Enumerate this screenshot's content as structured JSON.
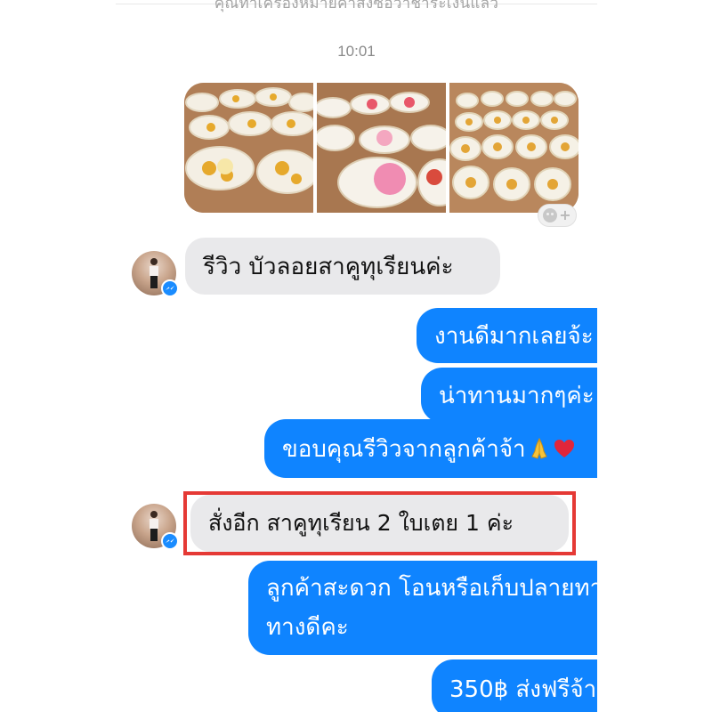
{
  "top_hint": "คุณทำเครื่องหมายคำสั่งซื้อว่าชำระเงินแล้ว",
  "timestamp": "10:01",
  "photos": [
    {
      "name": "photo-1"
    },
    {
      "name": "photo-2"
    },
    {
      "name": "photo-3"
    }
  ],
  "messages": {
    "review": "รีวิว บัวลอยสาคูทุเรียนค่ะ",
    "reply1": "งานดีมากเลยจ้ะ",
    "reply2": "น่าทานมากๆค่ะ",
    "reply3": "ขอบคุณรีวิวจากลูกค้าจ้า",
    "order": "สั่งอีก สาคูทุเรียน 2 ใบเตย 1 ค่ะ",
    "reply4_line1": "ลูกค้าสะดวก โอนหรือเก็บปลายทาง",
    "reply4_line2": "ทางดีคะ",
    "reply5": "350฿ ส่งฟรีจ้า"
  },
  "colors": {
    "outgoing_bubble": "#0f84ff",
    "incoming_bubble": "#e9e9eb",
    "highlight_border": "#e53935",
    "messenger_badge": "#1a8cff"
  },
  "icons": {
    "reaction": "add-reaction-icon",
    "badge": "messenger-icon",
    "pray": "folded-hands-emoji",
    "heart": "red-heart-emoji"
  }
}
